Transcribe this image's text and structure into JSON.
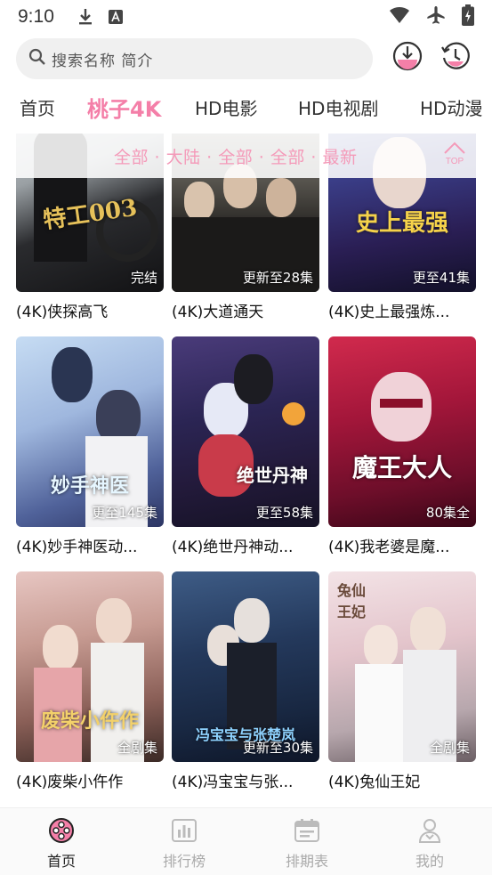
{
  "status": {
    "time": "9:10"
  },
  "search": {
    "placeholder": "搜索名称 简介"
  },
  "tabs": [
    {
      "label": "首页"
    },
    {
      "label": "桃子4K"
    },
    {
      "label": "HD电影"
    },
    {
      "label": "HD电视剧"
    },
    {
      "label": "HD动漫"
    }
  ],
  "filter": {
    "text": "全部 · 大陆 · 全部 · 全部 · 最新",
    "top_label": "TOP"
  },
  "cards": [
    {
      "title": "(4K)侠探高飞",
      "badge": "完结",
      "poster_text": "特工003"
    },
    {
      "title": "(4K)大道通天",
      "badge": "更新至28集",
      "poster_text": ""
    },
    {
      "title": "(4K)史上最强炼...",
      "badge": "更至41集",
      "poster_text": "史上最强"
    },
    {
      "title": "(4K)妙手神医动...",
      "badge": "更至145集",
      "poster_text": "妙手神医"
    },
    {
      "title": "(4K)绝世丹神动...",
      "badge": "更至58集",
      "poster_text": "绝世丹神"
    },
    {
      "title": "(4K)我老婆是魔...",
      "badge": "80集全",
      "poster_text": "魔王大人"
    },
    {
      "title": "(4K)废柴小仵作",
      "badge": "全剧集",
      "poster_text": "废柴小仵作"
    },
    {
      "title": "(4K)冯宝宝与张...",
      "badge": "更新至30集",
      "poster_text": "冯宝宝与张楚岚"
    },
    {
      "title": "(4K)兔仙王妃",
      "badge": "全剧集",
      "poster_text": "兔仙王妃"
    }
  ],
  "nav": [
    {
      "label": "首页"
    },
    {
      "label": "排行榜"
    },
    {
      "label": "排期表"
    },
    {
      "label": "我的"
    }
  ],
  "colors": {
    "accent": "#f47fa8",
    "filter": "#f49ab9"
  }
}
